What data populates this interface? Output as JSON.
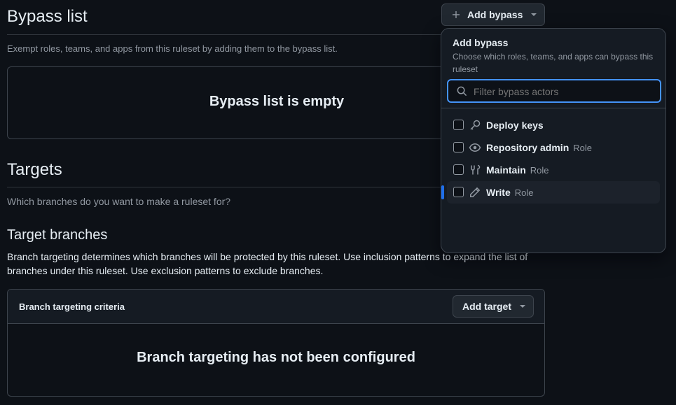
{
  "bypass": {
    "title": "Bypass list",
    "description": "Exempt roles, teams, and apps from this ruleset by adding them to the bypass list.",
    "empty_text": "Bypass list is empty",
    "add_button": "Add bypass"
  },
  "menu": {
    "title": "Add bypass",
    "subtitle": "Choose which roles, teams, and apps can bypass this ruleset",
    "filter_placeholder": "Filter bypass actors",
    "items": [
      {
        "label": "Deploy keys",
        "role": "",
        "icon": "key-icon",
        "checked": false
      },
      {
        "label": "Repository admin",
        "role": "Role",
        "icon": "eye-icon",
        "checked": false
      },
      {
        "label": "Maintain",
        "role": "Role",
        "icon": "tools-icon",
        "checked": false
      },
      {
        "label": "Write",
        "role": "Role",
        "icon": "pencil-icon",
        "checked": false
      }
    ]
  },
  "targets": {
    "title": "Targets",
    "description": "Which branches do you want to make a ruleset for?"
  },
  "target_branches": {
    "title": "Target branches",
    "description": "Branch targeting determines which branches will be protected by this ruleset. Use inclusion patterns to expand the list of branches under this ruleset. Use exclusion patterns to exclude branches.",
    "criteria_label": "Branch targeting criteria",
    "add_target_button": "Add target",
    "empty_text": "Branch targeting has not been configured"
  },
  "colors": {
    "background": "#0d1117",
    "accent": "#1f6feb",
    "focus_border": "#4493f8"
  }
}
